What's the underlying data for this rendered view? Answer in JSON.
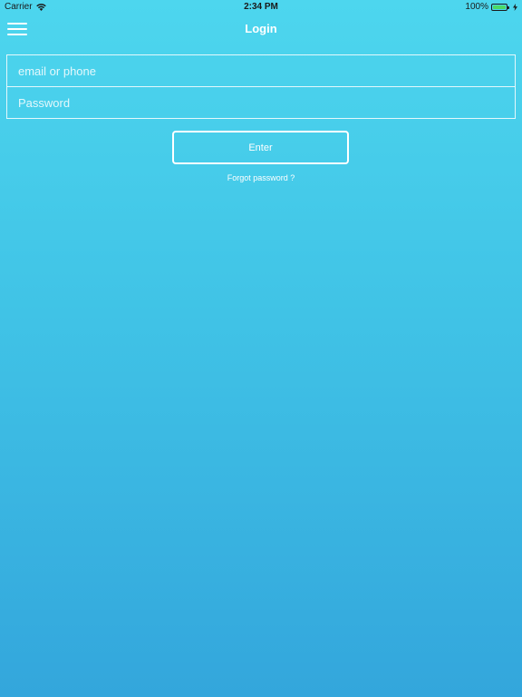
{
  "status_bar": {
    "carrier": "Carrier",
    "time": "2:34 PM",
    "battery": "100%",
    "battery_level": 1.0,
    "battery_color": "#4cd964"
  },
  "nav": {
    "title": "Login",
    "menu_icon": "hamburger-menu-icon"
  },
  "form": {
    "email_placeholder": "email or phone",
    "email_value": "",
    "password_placeholder": "Password",
    "password_value": "",
    "enter_label": "Enter",
    "forgot_label": "Forgot password ?"
  },
  "colors": {
    "background_top": "#4dd6ee",
    "background_bottom": "#33a6dc",
    "foreground": "#ffffff"
  }
}
